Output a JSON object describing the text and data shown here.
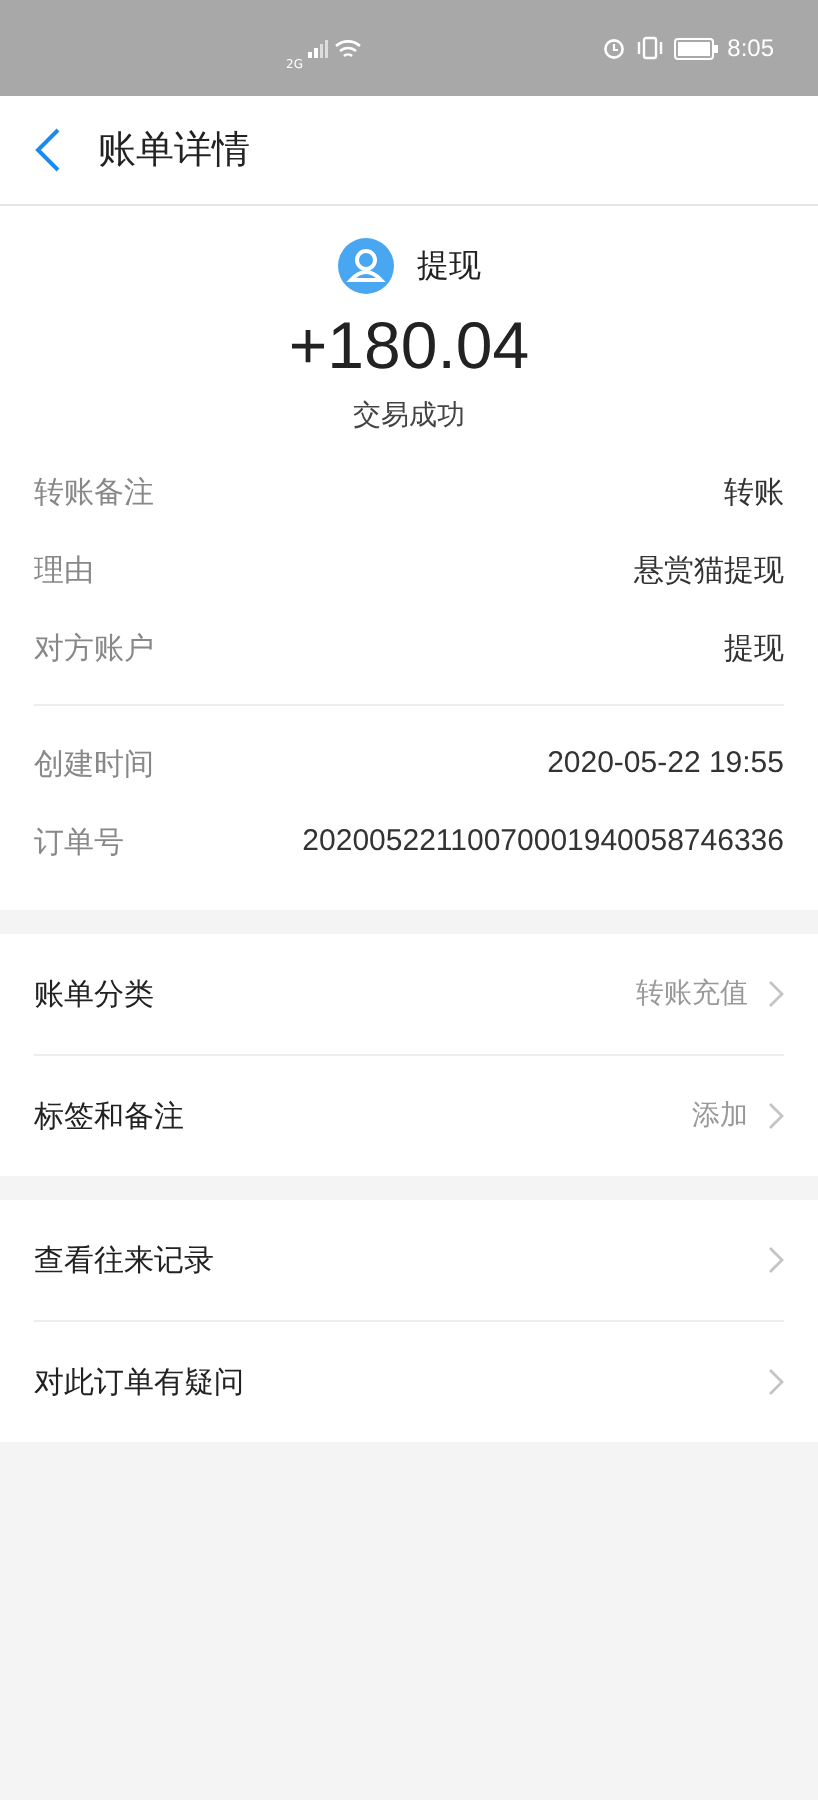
{
  "status_bar": {
    "network": "2G",
    "time": "8:05"
  },
  "header": {
    "title": "账单详情"
  },
  "summary": {
    "name": "提现",
    "amount": "+180.04",
    "status": "交易成功"
  },
  "detail_groups": [
    {
      "rows": [
        {
          "label": "转账备注",
          "value": "转账"
        },
        {
          "label": "理由",
          "value": "悬赏猫提现"
        },
        {
          "label": "对方账户",
          "value": "提现"
        }
      ]
    },
    {
      "rows": [
        {
          "label": "创建时间",
          "value": "2020-05-22 19:55"
        },
        {
          "label": "订单号",
          "value": "20200522110070001940058746336"
        }
      ]
    }
  ],
  "menu_groups": [
    {
      "items": [
        {
          "label": "账单分类",
          "value": "转账充值"
        },
        {
          "label": "标签和备注",
          "value": "添加"
        }
      ]
    },
    {
      "items": [
        {
          "label": "查看往来记录"
        },
        {
          "label": "对此订单有疑问"
        }
      ]
    }
  ]
}
